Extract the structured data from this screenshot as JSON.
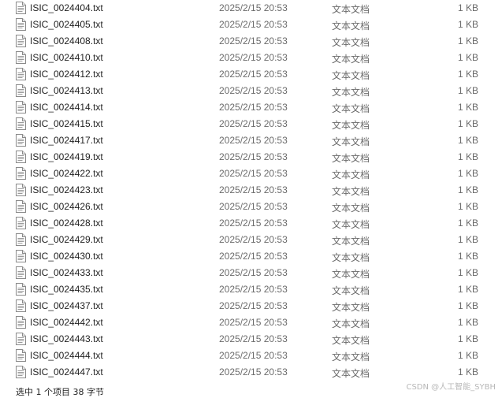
{
  "files": [
    {
      "name": "ISIC_0024404.txt",
      "date": "2025/2/15 20:53",
      "type": "文本文档",
      "size": "1 KB"
    },
    {
      "name": "ISIC_0024405.txt",
      "date": "2025/2/15 20:53",
      "type": "文本文档",
      "size": "1 KB"
    },
    {
      "name": "ISIC_0024408.txt",
      "date": "2025/2/15 20:53",
      "type": "文本文档",
      "size": "1 KB"
    },
    {
      "name": "ISIC_0024410.txt",
      "date": "2025/2/15 20:53",
      "type": "文本文档",
      "size": "1 KB"
    },
    {
      "name": "ISIC_0024412.txt",
      "date": "2025/2/15 20:53",
      "type": "文本文档",
      "size": "1 KB"
    },
    {
      "name": "ISIC_0024413.txt",
      "date": "2025/2/15 20:53",
      "type": "文本文档",
      "size": "1 KB"
    },
    {
      "name": "ISIC_0024414.txt",
      "date": "2025/2/15 20:53",
      "type": "文本文档",
      "size": "1 KB"
    },
    {
      "name": "ISIC_0024415.txt",
      "date": "2025/2/15 20:53",
      "type": "文本文档",
      "size": "1 KB"
    },
    {
      "name": "ISIC_0024417.txt",
      "date": "2025/2/15 20:53",
      "type": "文本文档",
      "size": "1 KB"
    },
    {
      "name": "ISIC_0024419.txt",
      "date": "2025/2/15 20:53",
      "type": "文本文档",
      "size": "1 KB"
    },
    {
      "name": "ISIC_0024422.txt",
      "date": "2025/2/15 20:53",
      "type": "文本文档",
      "size": "1 KB"
    },
    {
      "name": "ISIC_0024423.txt",
      "date": "2025/2/15 20:53",
      "type": "文本文档",
      "size": "1 KB"
    },
    {
      "name": "ISIC_0024426.txt",
      "date": "2025/2/15 20:53",
      "type": "文本文档",
      "size": "1 KB"
    },
    {
      "name": "ISIC_0024428.txt",
      "date": "2025/2/15 20:53",
      "type": "文本文档",
      "size": "1 KB"
    },
    {
      "name": "ISIC_0024429.txt",
      "date": "2025/2/15 20:53",
      "type": "文本文档",
      "size": "1 KB"
    },
    {
      "name": "ISIC_0024430.txt",
      "date": "2025/2/15 20:53",
      "type": "文本文档",
      "size": "1 KB"
    },
    {
      "name": "ISIC_0024433.txt",
      "date": "2025/2/15 20:53",
      "type": "文本文档",
      "size": "1 KB"
    },
    {
      "name": "ISIC_0024435.txt",
      "date": "2025/2/15 20:53",
      "type": "文本文档",
      "size": "1 KB"
    },
    {
      "name": "ISIC_0024437.txt",
      "date": "2025/2/15 20:53",
      "type": "文本文档",
      "size": "1 KB"
    },
    {
      "name": "ISIC_0024442.txt",
      "date": "2025/2/15 20:53",
      "type": "文本文档",
      "size": "1 KB"
    },
    {
      "name": "ISIC_0024443.txt",
      "date": "2025/2/15 20:53",
      "type": "文本文档",
      "size": "1 KB"
    },
    {
      "name": "ISIC_0024444.txt",
      "date": "2025/2/15 20:53",
      "type": "文本文档",
      "size": "1 KB"
    },
    {
      "name": "ISIC_0024447.txt",
      "date": "2025/2/15 20:53",
      "type": "文本文档",
      "size": "1 KB"
    }
  ],
  "file_icon": "text-file-icon",
  "status_bar": {
    "text": "选中 1 个项目  38 字节"
  },
  "watermark": {
    "text": "CSDN @人工智能_SYBH"
  }
}
